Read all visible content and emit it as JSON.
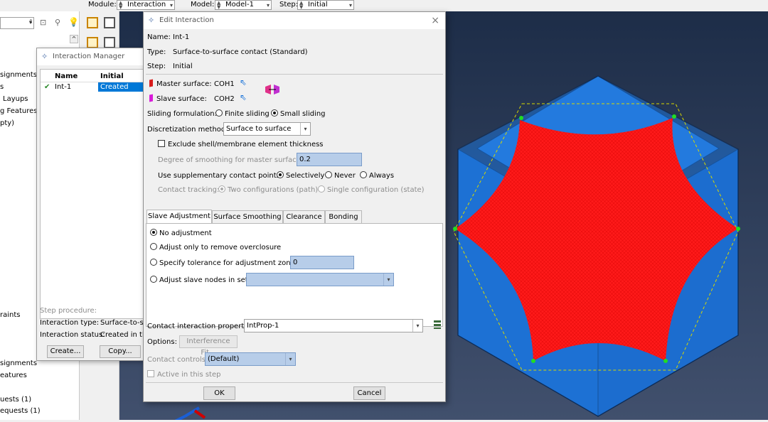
{
  "toolbar": {
    "module_label": "Module:",
    "module_value": "Interaction",
    "model_label": "Model:",
    "model_value": "Model-1",
    "step_label": "Step:",
    "step_value": "Initial"
  },
  "left_tree": {
    "items": [
      "signments",
      "s",
      "Layups",
      "g Features",
      "pty)",
      "raints",
      "signments",
      "eatures",
      "uests (1)",
      "equests (1)"
    ]
  },
  "manager": {
    "title": "Interaction Manager",
    "col_name": "Name",
    "col_initial": "Initial",
    "row_check": "✔",
    "row_name": "Int-1",
    "row_state": "Created",
    "step_procedure_label": "Step procedure:",
    "interaction_type_label": "Interaction type:",
    "interaction_type_value": "Surface-to-su",
    "interaction_status_label": "Interaction status:",
    "interaction_status_value": "Created in th",
    "create_btn": "Create...",
    "copy_btn": "Copy..."
  },
  "dialog": {
    "title": "Edit Interaction",
    "close": "×",
    "name_label": "Name:",
    "name_value": "Int-1",
    "type_label": "Type:",
    "type_value": "Surface-to-surface contact (Standard)",
    "step_label": "Step:",
    "step_value": "Initial",
    "master_label": "Master surface:",
    "master_value": "COH1",
    "slave_label": "Slave surface:",
    "slave_value": "COH2",
    "sliding_label": "Sliding formulation:",
    "sliding_finite": "Finite sliding",
    "sliding_small": "Small sliding",
    "discretization_label": "Discretization method:",
    "discretization_value": "Surface to surface",
    "exclude_label": "Exclude shell/membrane element thickness",
    "smoothing_label": "Degree of smoothing for master surface:",
    "smoothing_value": "0.2",
    "supp_label": "Use supplementary contact points:",
    "supp_selectively": "Selectively",
    "supp_never": "Never",
    "supp_always": "Always",
    "tracking_label": "Contact tracking:",
    "tracking_two": "Two configurations (path)",
    "tracking_single": "Single configuration (state)",
    "tabs": [
      "Slave Adjustment",
      "Surface Smoothing",
      "Clearance",
      "Bonding"
    ],
    "adj_none": "No adjustment",
    "adj_overclosure": "Adjust only to remove overclosure",
    "adj_tolerance": "Specify tolerance for adjustment zone:",
    "adj_tolerance_value": "0",
    "adj_set": "Adjust slave nodes in set:",
    "property_label": "Contact interaction property:",
    "property_value": "IntProp-1",
    "options_label": "Options:",
    "interference_btn": "Interference Fit...",
    "controls_label": "Contact controls:",
    "controls_value": "(Default)",
    "active_label": "Active in this step",
    "ok_btn": "OK",
    "cancel_btn": "Cancel"
  },
  "colors": {
    "viewport_top": "#1d2d48",
    "cube_blue": "#1a73d9",
    "mesh_red": "#ff1a1a",
    "selection_blue": "#0078d7"
  }
}
